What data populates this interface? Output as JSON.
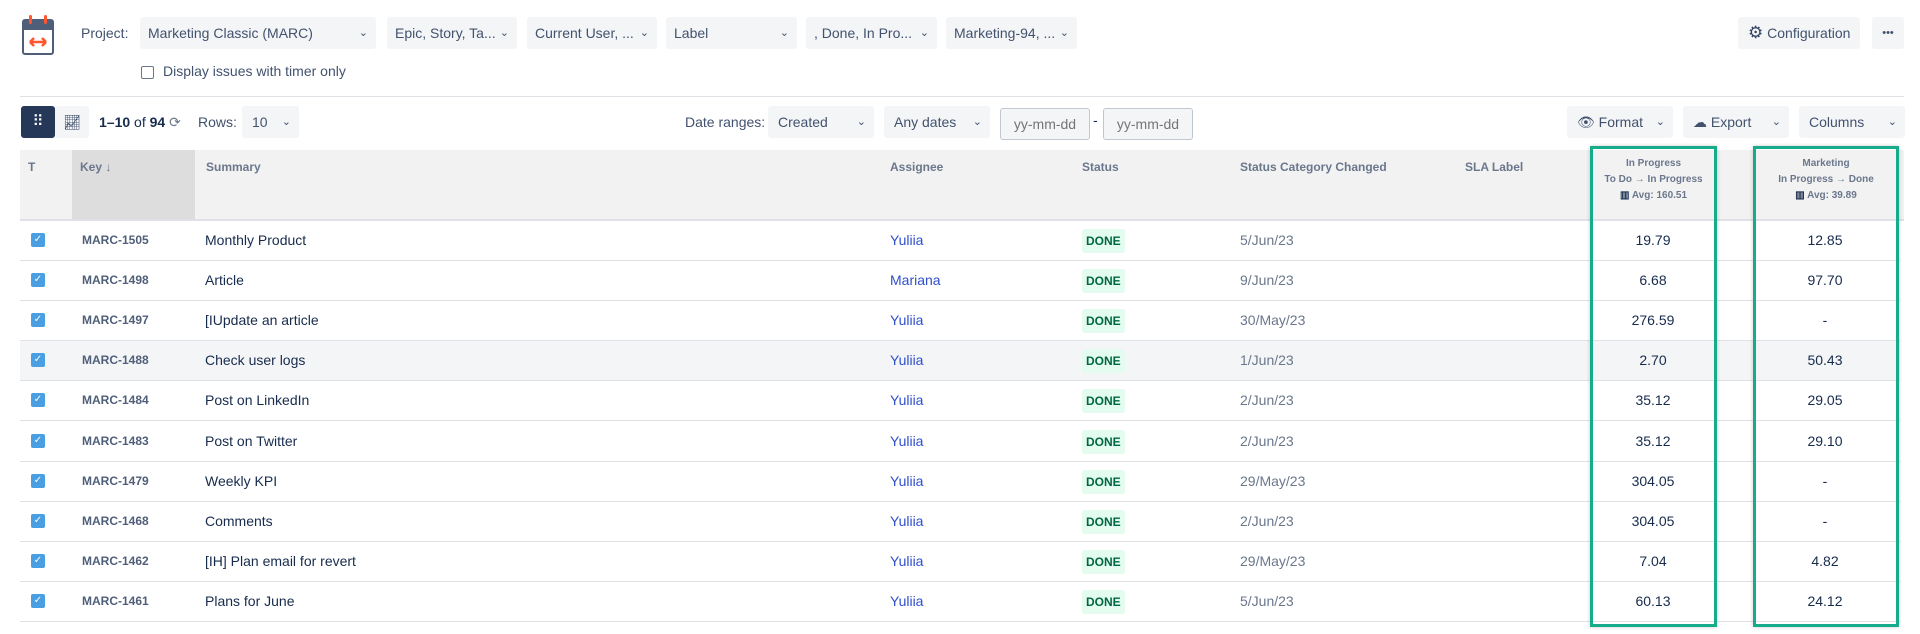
{
  "header": {
    "project_label": "Project:",
    "filters": [
      "Marketing Classic (MARC)",
      "Epic, Story, Ta...",
      "Current User, ...",
      "Label",
      ", Done, In Pro...",
      "Marketing-94, ..."
    ],
    "timer_checkbox_label": "Display issues with timer only",
    "configuration_label": "Configuration",
    "more_label": "•••"
  },
  "toolbar": {
    "range": "1–10",
    "of": "of",
    "total": "94",
    "rows_label": "Rows:",
    "rows_value": "10",
    "date_ranges_label": "Date ranges:",
    "date_field": "Created",
    "date_period": "Any dates",
    "date_from_placeholder": "yy-mm-dd",
    "date_sep": "-",
    "date_to_placeholder": "yy-mm-dd",
    "format_label": "Format",
    "export_label": "Export",
    "columns_label": "Columns"
  },
  "columns": {
    "t": "T",
    "key": "Key ↓",
    "summary": "Summary",
    "assignee": "Assignee",
    "status": "Status",
    "status_changed": "Status Category Changed",
    "sla": "SLA Label",
    "in_progress": {
      "title": "In Progress",
      "transition": "To Do → In Progress",
      "avg": "Avg: 160.51"
    },
    "marketing": {
      "title": "Marketing",
      "transition": "In Progress → Done",
      "avg": "Avg: 39.89"
    }
  },
  "rows": [
    {
      "key": "MARC-1505",
      "summary": "Monthly Product",
      "assignee": "Yuliia",
      "status": "DONE",
      "changed": "5/Jun/23",
      "in_progress": "19.79",
      "marketing": "12.85"
    },
    {
      "key": "MARC-1498",
      "summary": "Article",
      "assignee": "Mariana",
      "status": "DONE",
      "changed": "9/Jun/23",
      "in_progress": "6.68",
      "marketing": "97.70"
    },
    {
      "key": "MARC-1497",
      "summary": "[IUpdate an article",
      "assignee": "Yuliia",
      "status": "DONE",
      "changed": "30/May/23",
      "in_progress": "276.59",
      "marketing": "-"
    },
    {
      "key": "MARC-1488",
      "summary": "Check user logs",
      "assignee": "Yuliia",
      "status": "DONE",
      "changed": "1/Jun/23",
      "in_progress": "2.70",
      "marketing": "50.43"
    },
    {
      "key": "MARC-1484",
      "summary": "Post on LinkedIn",
      "assignee": "Yuliia",
      "status": "DONE",
      "changed": "2/Jun/23",
      "in_progress": "35.12",
      "marketing": "29.05"
    },
    {
      "key": "MARC-1483",
      "summary": "Post on Twitter",
      "assignee": "Yuliia",
      "status": "DONE",
      "changed": "2/Jun/23",
      "in_progress": "35.12",
      "marketing": "29.10"
    },
    {
      "key": "MARC-1479",
      "summary": "Weekly KPI",
      "assignee": "Yuliia",
      "status": "DONE",
      "changed": "29/May/23",
      "in_progress": "304.05",
      "marketing": "-"
    },
    {
      "key": "MARC-1468",
      "summary": "Comments",
      "assignee": "Yuliia",
      "status": "DONE",
      "changed": "2/Jun/23",
      "in_progress": "304.05",
      "marketing": "-"
    },
    {
      "key": "MARC-1462",
      "summary": "[IH] Plan email for revert",
      "assignee": "Yuliia",
      "status": "DONE",
      "changed": "29/May/23",
      "in_progress": "7.04",
      "marketing": "4.82"
    },
    {
      "key": "MARC-1461",
      "summary": " Plans for June",
      "assignee": "Yuliia",
      "status": "DONE",
      "changed": "5/Jun/23",
      "in_progress": "60.13",
      "marketing": "24.12"
    }
  ]
}
